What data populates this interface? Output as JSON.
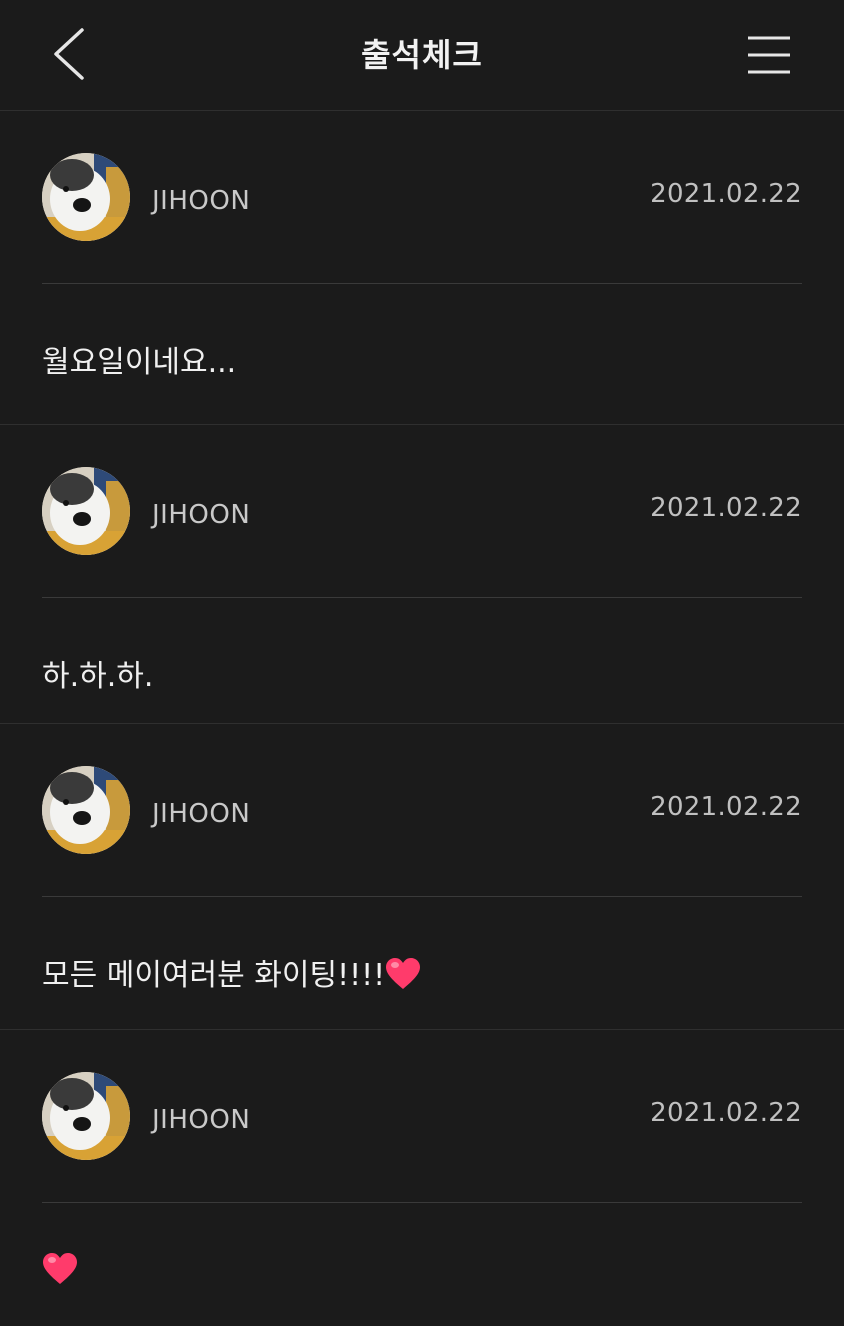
{
  "header": {
    "title": "출석체크",
    "back_icon": "chevron-left-icon",
    "menu_icon": "hamburger-menu-icon"
  },
  "posts": [
    {
      "author": "JIHOON",
      "date": "2021.02.22",
      "text": "월요일이네요..."
    },
    {
      "author": "JIHOON",
      "date": "2021.02.22",
      "text": "하.하.하."
    },
    {
      "author": "JIHOON",
      "date": "2021.02.22",
      "text": "모든 메이여러분 화이팅!!!!",
      "emoji": "heart"
    },
    {
      "author": "JIHOON",
      "date": "2021.02.22",
      "text": "",
      "emoji": "heart"
    }
  ],
  "colors": {
    "background": "#1b1b1b",
    "heart": "#ff3b6b",
    "divider": "#3a3a3a"
  }
}
